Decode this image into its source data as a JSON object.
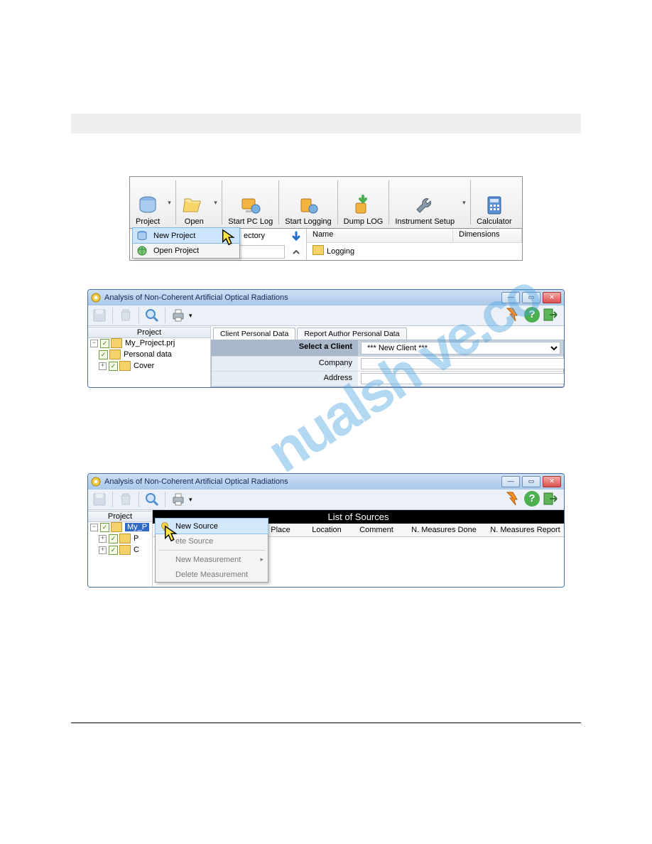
{
  "fig1": {
    "toolbar": [
      {
        "label": "Project"
      },
      {
        "label": "Open"
      },
      {
        "label": "Start PC Log"
      },
      {
        "label": "Start Logging"
      },
      {
        "label": "Dump LOG"
      },
      {
        "label": "Instrument Setup"
      },
      {
        "label": "Calculator"
      }
    ],
    "menu": {
      "item1": "New Project",
      "item2": "Open Project"
    },
    "dir_label": "ectory",
    "list": {
      "col_name": "Name",
      "col_dim": "Dimensions",
      "row1": "Logging"
    }
  },
  "fig2": {
    "title": "Analysis of Non-Coherent Artificial Optical Radiations",
    "tree_header": "Project",
    "tree": {
      "root": "My_Project.prj",
      "n1": "Personal data",
      "n2": "Cover"
    },
    "tabs": {
      "t1": "Client Personal Data",
      "t2": "Report Author Personal Data"
    },
    "form": {
      "select_label": "Select a Client",
      "select_value": "*** New Client ***",
      "company_label": "Company",
      "address_label": "Address"
    }
  },
  "fig3": {
    "title": "Analysis of Non-Coherent Artificial Optical Radiations",
    "tree_header": "Project",
    "tree": {
      "root": "My_P",
      "n1": "P",
      "n2": "C"
    },
    "black_header": "List of Sources",
    "columns": {
      "c1": "Place",
      "c2": "Location",
      "c3": "Comment",
      "c4": "N. Measures Done",
      "c5": "N. Measures Report"
    },
    "context": {
      "m1": "New Source",
      "m2": "ete Source",
      "m3": "New Measurement",
      "m4": "Delete Measurement"
    }
  }
}
